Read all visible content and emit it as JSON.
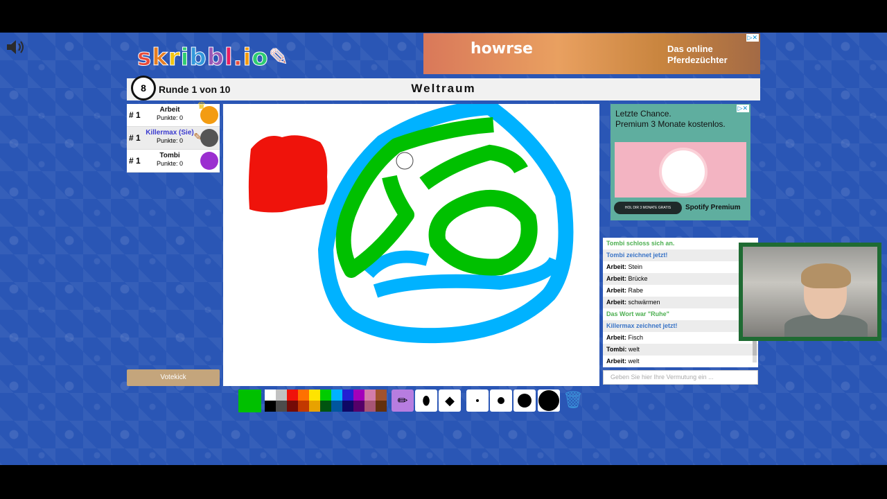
{
  "logo": {
    "text": "skribbl.io",
    "letters": [
      {
        "ch": "s",
        "color": "#e74c3c"
      },
      {
        "ch": "k",
        "color": "#e67e22"
      },
      {
        "ch": "r",
        "color": "#f1c40f"
      },
      {
        "ch": "i",
        "color": "#2ecc71"
      },
      {
        "ch": "b",
        "color": "#3498db"
      },
      {
        "ch": "b",
        "color": "#9b59b6"
      },
      {
        "ch": "l",
        "color": "#e91e63"
      },
      {
        "ch": ".",
        "color": "#e74c3c"
      },
      {
        "ch": "i",
        "color": "#f39c12"
      },
      {
        "ch": "o",
        "color": "#2ecc71"
      }
    ]
  },
  "ad_top": {
    "brand": "howrse",
    "line1": "Das online",
    "line2": "Pferdezüchter"
  },
  "topbar": {
    "clock": "8",
    "round_text": "Runde 1 von 10",
    "word": "Weltraum"
  },
  "players": [
    {
      "rank": "# 1",
      "name": "Arbeit",
      "score": "Punkte: 0",
      "color": "#f39c12",
      "name_color": "#111111"
    },
    {
      "rank": "# 1",
      "name": "Killermax (Sie)",
      "score": "Punkte: 0",
      "color": "#555555",
      "name_color": "#3a3acf"
    },
    {
      "rank": "# 1",
      "name": "Tombi",
      "score": "Punkte: 0",
      "color": "#9b2fd0",
      "name_color": "#111111"
    }
  ],
  "votekick": "Votekick",
  "ad_side": {
    "headline1": "Letzte Chance.",
    "headline2": "Premium 3 Monate kostenlos.",
    "button": "HOL DIR 3 MONATE GRATIS",
    "brand": "Spotify Premium"
  },
  "chat": [
    {
      "type": "sys-green",
      "text": "Tombi schloss sich an."
    },
    {
      "type": "sys-blue",
      "text": "Tombi zeichnet jetzt!"
    },
    {
      "type": "msg",
      "author": "Arbeit:",
      "text": "Stein"
    },
    {
      "type": "msg",
      "author": "Arbeit:",
      "text": "Brücke"
    },
    {
      "type": "msg",
      "author": "Arbeit:",
      "text": "Rabe"
    },
    {
      "type": "msg",
      "author": "Arbeit:",
      "text": "schwärmen"
    },
    {
      "type": "sys-green",
      "text": "Das Wort war \"Ruhe\""
    },
    {
      "type": "sys-blue",
      "text": "Killermax zeichnet jetzt!"
    },
    {
      "type": "msg",
      "author": "Arbeit:",
      "text": "Fisch"
    },
    {
      "type": "msg",
      "author": "Tombi:",
      "text": "welt"
    },
    {
      "type": "msg",
      "author": "Arbeit:",
      "text": "welt"
    }
  ],
  "chat_placeholder": "Geben Sie hier Ihre Vermutung ein ...",
  "current_color": "#00c000",
  "palette_top": [
    "#ffffff",
    "#c1c1c1",
    "#ef130b",
    "#ff7100",
    "#ffe400",
    "#00cc00",
    "#00b2ff",
    "#231fd3",
    "#a300ba",
    "#d37caa",
    "#a0522d"
  ],
  "palette_bottom": [
    "#000000",
    "#4c4c4c",
    "#740b07",
    "#c23800",
    "#e8a200",
    "#005510",
    "#00569e",
    "#0e0865",
    "#550069",
    "#a75574",
    "#63300d"
  ],
  "tools": [
    {
      "name": "pencil-tool",
      "icon": "✏",
      "active": true
    },
    {
      "name": "eraser-tool",
      "icon": "⬮",
      "active": false
    },
    {
      "name": "fill-tool",
      "icon": "◆",
      "active": false
    }
  ],
  "brush_sizes": [
    "small",
    "medium",
    "large",
    "xlarge"
  ]
}
